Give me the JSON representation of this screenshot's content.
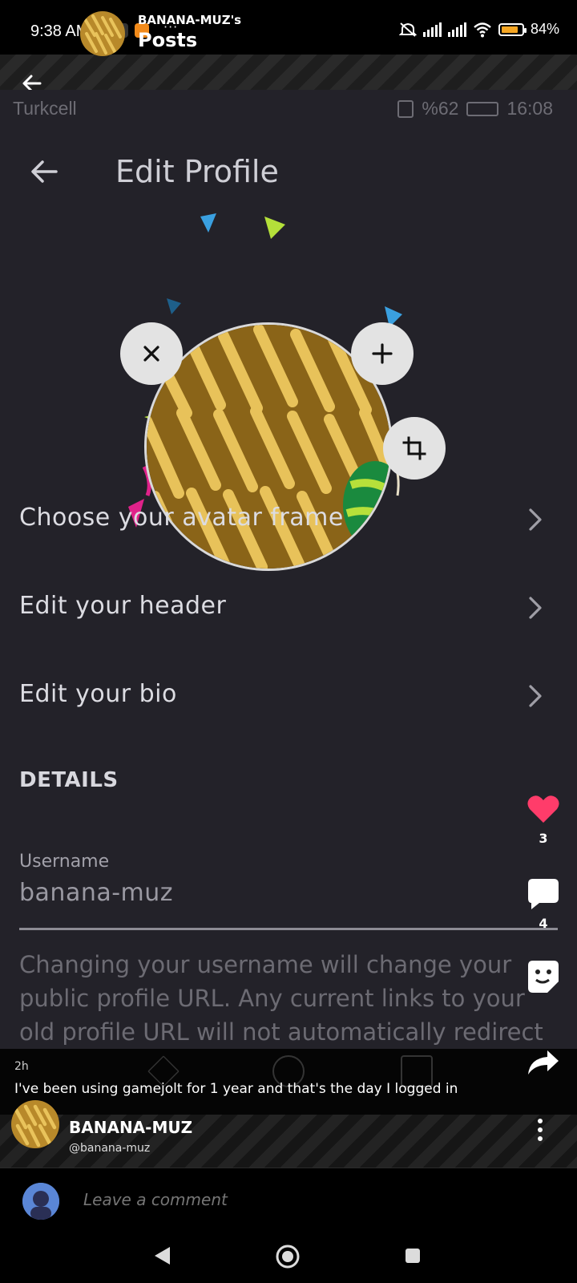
{
  "status_bar": {
    "time": "9:38 AM",
    "dots": "···",
    "battery_pct": "84%"
  },
  "post_header": {
    "owner": "BANANA-MUZ's",
    "title": "Posts"
  },
  "inner_status": {
    "carrier": "Turkcell",
    "signal": "%62",
    "time": "16:08"
  },
  "edit_profile": {
    "title": "Edit Profile",
    "menu": [
      {
        "label": "Choose your avatar frame"
      },
      {
        "label": "Edit your header"
      },
      {
        "label": "Edit your bio"
      }
    ],
    "details_heading": "DETAILS",
    "username_label": "Username",
    "username_value": "banana-muz",
    "helper_text": "Changing your username will change your public profile URL. Any current links to your old profile URL will not automatically redirect to"
  },
  "rail": {
    "likes": "3",
    "comments": "4"
  },
  "caption": {
    "ago": "2h",
    "text": "I've been using gamejolt for 1 year and that's the day I logged in"
  },
  "author": {
    "name": "BANANA-MUZ",
    "handle": "@banana-muz"
  },
  "comment": {
    "placeholder": "Leave a comment"
  },
  "colors": {
    "background": "#232229",
    "like": "#ff3c6a",
    "battery": "#f5a623"
  }
}
